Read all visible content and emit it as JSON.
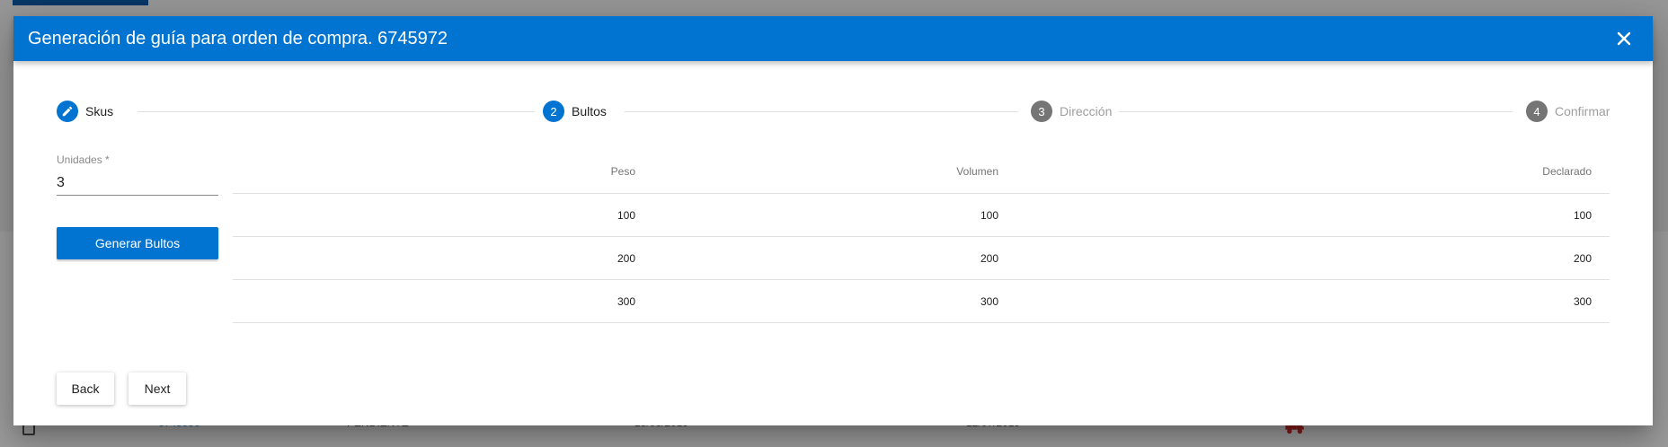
{
  "background": {
    "row": {
      "order": "6745990",
      "status": "PENDIENTE",
      "date1": "15/08/2019",
      "date2": "12/07/2019"
    }
  },
  "dialog": {
    "title": "Generación de guía para orden de compra. 6745972",
    "close_icon": "close-icon"
  },
  "stepper": {
    "steps": [
      {
        "number": "",
        "label": "Skus",
        "state": "edit",
        "icon": "pencil-icon"
      },
      {
        "number": "2",
        "label": "Bultos",
        "state": "active"
      },
      {
        "number": "3",
        "label": "Dirección",
        "state": "inactive"
      },
      {
        "number": "4",
        "label": "Confirmar",
        "state": "inactive"
      }
    ]
  },
  "form": {
    "units_label": "Unidades *",
    "units_value": "3",
    "generate_label": "Generar Bultos"
  },
  "table": {
    "headers": [
      "Peso",
      "Volumen",
      "Declarado"
    ],
    "rows": [
      [
        "100",
        "100",
        "100"
      ],
      [
        "200",
        "200",
        "200"
      ],
      [
        "300",
        "300",
        "300"
      ]
    ]
  },
  "footer": {
    "back_label": "Back",
    "next_label": "Next"
  },
  "colors": {
    "primary": "#0074d0",
    "inactive_step": "#757575",
    "delivery_icon": "#d32f2f"
  }
}
